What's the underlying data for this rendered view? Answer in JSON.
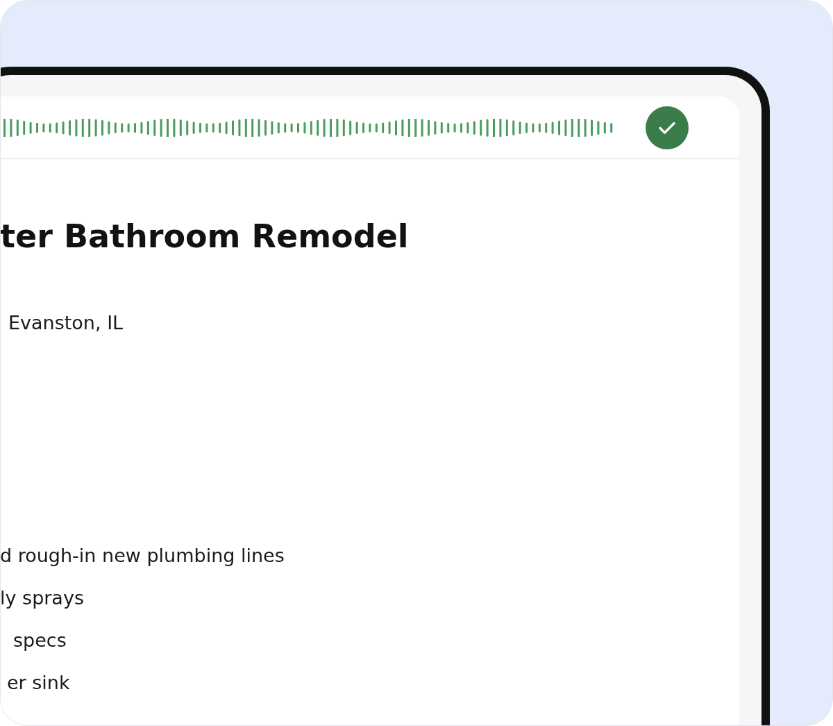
{
  "project": {
    "title": "ter Bathroom Remodel",
    "location": "Evanston, IL"
  },
  "scope_items": [
    "d rough-in new plumbing lines",
    "ly sprays",
    "specs",
    "er sink"
  ]
}
